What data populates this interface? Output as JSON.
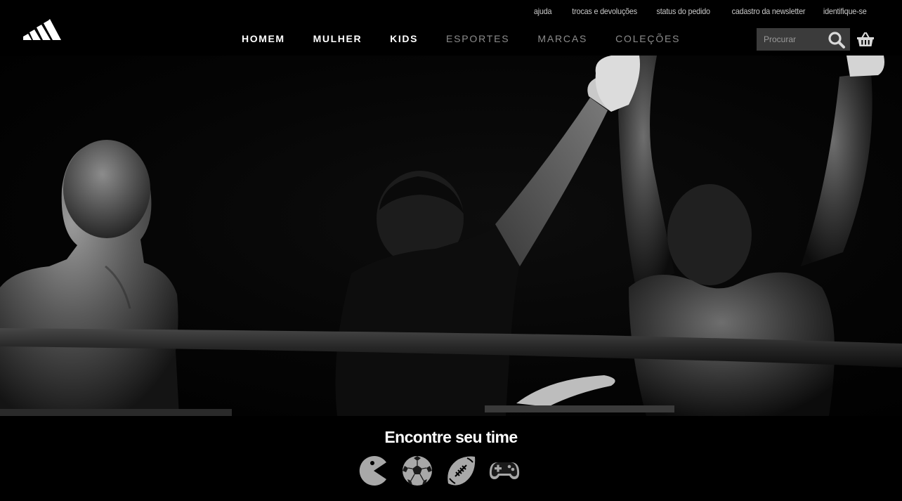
{
  "brand": {
    "logo": "adidas-three-stripes-logo"
  },
  "utility_nav": {
    "items": [
      {
        "label": "ajuda"
      },
      {
        "label": "trocas e devoluções"
      },
      {
        "label": "status do pedido"
      },
      {
        "label": "cadastro da newsletter"
      },
      {
        "label": "identifique-se"
      }
    ]
  },
  "main_nav": {
    "items": [
      {
        "label": "HOMEM"
      },
      {
        "label": "MULHER"
      },
      {
        "label": "KIDS"
      },
      {
        "label": "ESPORTES"
      },
      {
        "label": "MARCAS"
      },
      {
        "label": "COLEÇÕES"
      }
    ]
  },
  "search": {
    "placeholder": "Procurar",
    "value": "",
    "icon": "search-icon"
  },
  "cart": {
    "icon": "shopping-basket-icon"
  },
  "hero": {
    "image": "boxing-ring-victory-photo"
  },
  "team_section": {
    "title": "Encontre seu time",
    "icons": [
      {
        "name": "pacman-icon"
      },
      {
        "name": "soccer-ball-icon"
      },
      {
        "name": "american-football-icon"
      },
      {
        "name": "gamepad-icon"
      }
    ]
  },
  "colors": {
    "background": "#000000",
    "nav_active": "#ffffff",
    "nav_inactive": "#8c8c8c",
    "utility_text": "#c9c9c9",
    "search_bg": "#3b3b3b",
    "icon_gray": "#a8a8a8"
  }
}
